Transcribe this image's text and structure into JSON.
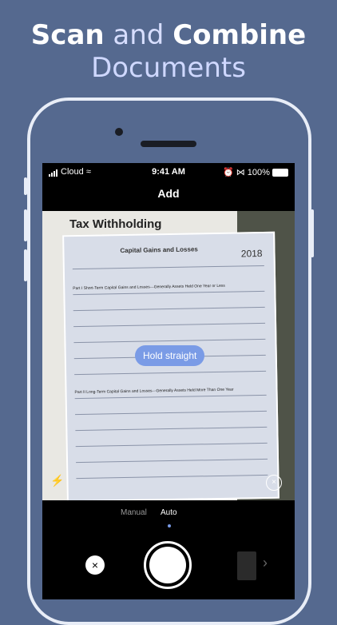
{
  "hero": {
    "scan": "Scan",
    "and": "and",
    "combine": "Combine",
    "documents": "Documents"
  },
  "status": {
    "carrier": "Cloud",
    "time": "9:41 AM",
    "battery": "100%"
  },
  "screen_title": "Add",
  "document_text": {
    "header": "Tax Withholding",
    "section": "Capital Gains and Losses",
    "year": "2018",
    "part1": "Part I Short-Term Capital Gains and Losses—Generally Assets Held One Year or Less",
    "part2": "Part II Long-Term Capital Gains and Losses—Generally Assets Held More Than One Year"
  },
  "hint": "Hold straight",
  "modes": {
    "manual": "Manual",
    "auto": "Auto"
  },
  "icons": {
    "flash": "flash-off-icon",
    "close": "close-icon",
    "cancel": "cancel-icon",
    "next": "chevron-right-icon"
  },
  "colors": {
    "background": "#55698f",
    "accent": "#7a9be6"
  }
}
